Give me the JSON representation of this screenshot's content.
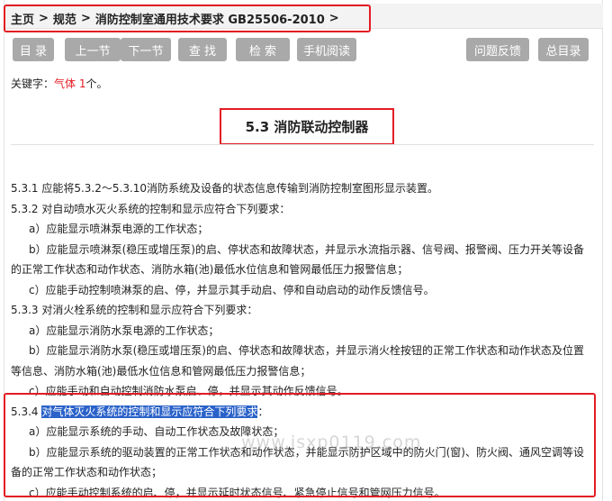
{
  "breadcrumb": {
    "home": "主页",
    "category": "规范",
    "document": "消防控制室通用技术要求 GB25506-2010",
    "separator": ">"
  },
  "toolbar": {
    "toc": "目 录",
    "prev": "上一节",
    "next": "下一节",
    "find": "查 找",
    "search": "检 索",
    "mobile": "手机阅读",
    "feedback": "问题反馈",
    "index": "总目录"
  },
  "keyword": {
    "label": "关键字：",
    "term": "气体",
    "count": "1",
    "unit": "个。"
  },
  "section": {
    "title": "5.3 消防联动控制器"
  },
  "paragraphs": {
    "p531": "5.3.1 应能将5.3.2～5.3.10消防系统及设备的状态信息传输到消防控制室图形显示装置。",
    "p532": "5.3.2 对自动喷水灭火系统的控制和显示应符合下列要求：",
    "p532a": "a）应能显示喷淋泵电源的工作状态；",
    "p532b": "b）应能显示喷淋泵(稳压或增压泵)的启、停状态和故障状态，并显示水流指示器、信号阀、报警阀、压力开关等设备的正常工作状态和动作状态、消防水箱(池)最低水位信息和管网最低压力报警信息；",
    "p532c": "c）应能手动控制喷淋泵的启、停，并显示其手动启、停和自动启动的动作反馈信号。",
    "p533": "5.3.3 对消火栓系统的控制和显示应符合下列要求：",
    "p533a": "a）应能显示消防水泵电源的工作状态；",
    "p533b": "b）应能显示消防水泵(稳压或增压泵)的启、停状态和故障状态，并显示消火栓按钮的正常工作状态和动作状态及位置等信息、消防水箱(池)最低水位信息和管网最低压力报警信息；",
    "p533c": "c）应能手动和自动控制消防水泵启、停，并显示其动作反馈信号。",
    "p534_num": "5.3.4 ",
    "p534_hl": "对气体灭火系统的控制和显示应符合下列要求",
    "p534_tail": "：",
    "p534a": "a）应能显示系统的手动、自动工作状态及故障状态；",
    "p534b": "b）应能显示系统的驱动装置的正常工作状态和动作状态，并能显示防护区域中的防火门(窗)、防火阀、通风空调等设备的正常工作状态和动作状态；",
    "p534c": "c）应能手动控制系统的启、停，并显示延时状态信号、紧急停止信号和管网压力信号。"
  },
  "watermark": "www.jsxp0119.com",
  "colors": {
    "accent_red": "#e31c23",
    "button_gray": "#a9a9a9",
    "selection_blue": "#2a62c9"
  }
}
